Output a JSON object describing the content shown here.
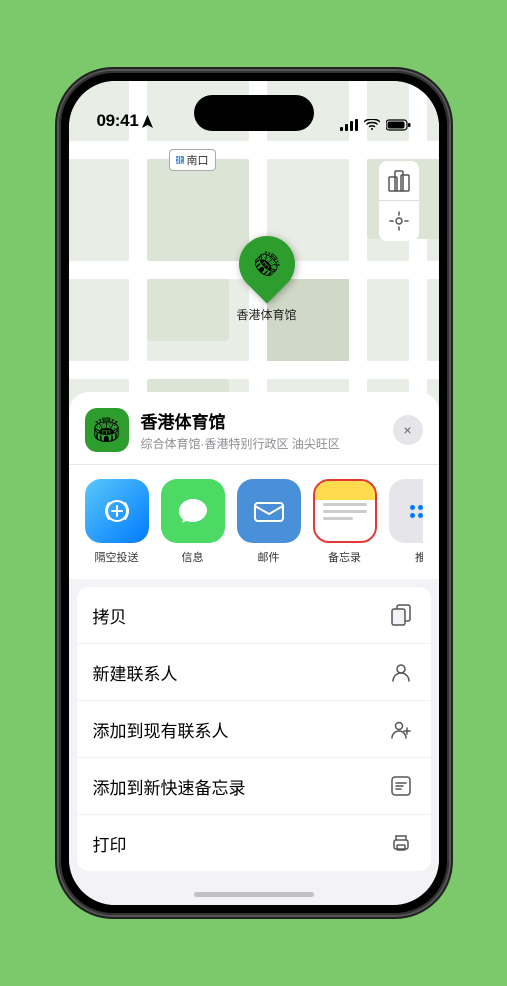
{
  "status": {
    "time": "09:41",
    "location_arrow": true
  },
  "map": {
    "label": "南口",
    "pin_label": "香港体育馆",
    "controls": [
      "map-type",
      "location"
    ]
  },
  "venue": {
    "name": "香港体育馆",
    "subtitle": "综合体育馆·香港特别行政区 油尖旺区",
    "icon": "🏟"
  },
  "share_items": [
    {
      "id": "airdrop",
      "label": "隔空投送",
      "type": "airdrop"
    },
    {
      "id": "message",
      "label": "信息",
      "type": "message"
    },
    {
      "id": "mail",
      "label": "邮件",
      "type": "mail"
    },
    {
      "id": "notes",
      "label": "备忘录",
      "type": "notes"
    },
    {
      "id": "more",
      "label": "推",
      "type": "more"
    }
  ],
  "actions": [
    {
      "id": "copy",
      "label": "拷贝",
      "icon": "copy"
    },
    {
      "id": "new-contact",
      "label": "新建联系人",
      "icon": "person"
    },
    {
      "id": "add-existing",
      "label": "添加到现有联系人",
      "icon": "person-add"
    },
    {
      "id": "add-notes",
      "label": "添加到新快速备忘录",
      "icon": "note"
    },
    {
      "id": "print",
      "label": "打印",
      "icon": "print"
    }
  ],
  "close_label": "×"
}
